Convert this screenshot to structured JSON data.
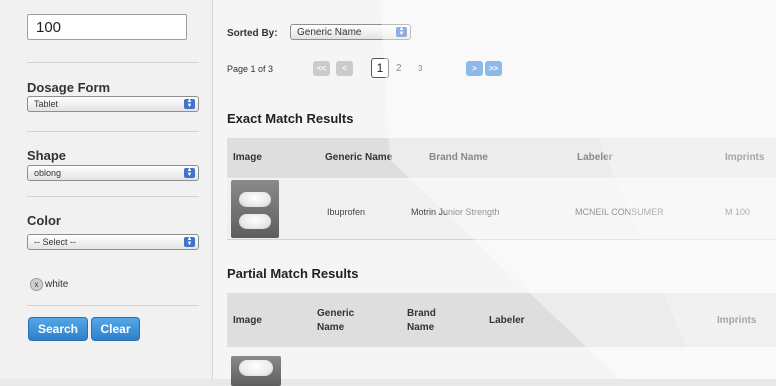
{
  "sidebar": {
    "imprint_value": "100",
    "dosage_form": {
      "label": "Dosage Form",
      "value": "Tablet"
    },
    "shape": {
      "label": "Shape",
      "value": "oblong"
    },
    "color": {
      "label": "Color",
      "value": "-- Select --",
      "selected_chip": "white"
    },
    "search_label": "Search",
    "clear_label": "Clear"
  },
  "main": {
    "sorted_by_label": "Sorted By:",
    "sort_value": "Generic Name",
    "page_info": "Page 1 of 3",
    "pagination": {
      "first": "<<",
      "prev": "<",
      "current": "1",
      "page2": "2",
      "page3": "3",
      "next": ">",
      "last": ">>"
    },
    "exact": {
      "title": "Exact Match Results",
      "headers": [
        "Image",
        "Generic Name",
        "Brand Name",
        "Labeler",
        "Imprints"
      ],
      "row": {
        "generic": "Ibuprofen",
        "brand": "Motrin Junior Strength",
        "labeler": "MCNEIL CONSUMER",
        "imprint": "M 100"
      }
    },
    "partial": {
      "title": "Partial Match Results",
      "headers": [
        "Image",
        "Generic Name",
        "Brand Name",
        "Labeler",
        "Imprints"
      ]
    }
  },
  "colors": {
    "accent": "#3b86d6",
    "button": "#2d7fcb"
  },
  "icons": [
    "select-arrow-icon",
    "remove-chip-icon",
    "pill-image-icon"
  ]
}
